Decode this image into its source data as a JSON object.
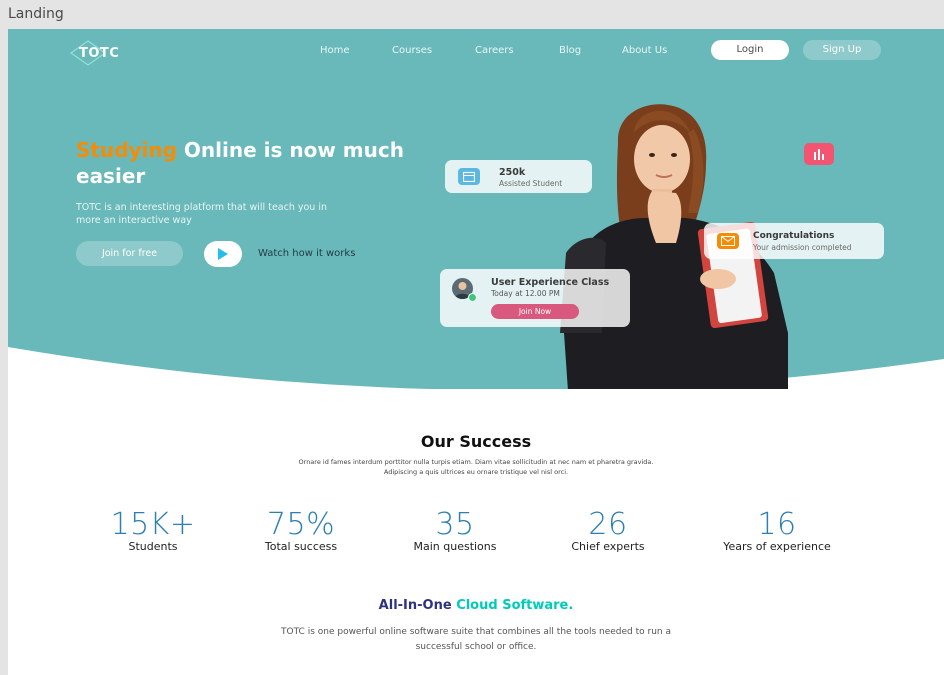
{
  "frame": {
    "label": "Landing"
  },
  "nav": {
    "logo_text": "TOTC",
    "links": [
      "Home",
      "Courses",
      "Careers",
      "Blog",
      "About Us"
    ],
    "login_label": "Login",
    "signup_label": "Sign Up"
  },
  "hero": {
    "title_accent": "Studying",
    "title_rest": " Online is now much easier",
    "description": "TOTC is an interesting platform that will teach you in more an interactive way",
    "join_label": "Join for free",
    "watch_label": "Watch how it works",
    "cards": {
      "assisted_value": "250k",
      "assisted_label": "Assisted Student",
      "congrats_title": "Congratulations",
      "congrats_sub": "Your admission completed",
      "class_title": "User Experience Class",
      "class_time": "Today at 12.00 PM",
      "class_button": "Join Now"
    }
  },
  "success": {
    "title": "Our Success",
    "description": "Ornare id fames interdum porttitor nulla turpis etiam. Diam vitae sollicitudin at nec nam et pharetra gravida. Adipiscing a quis ultrices eu ornare tristique vel nisl orci.",
    "stats": [
      {
        "value": "15K+",
        "label": "Students"
      },
      {
        "value": "75%",
        "label": "Total success"
      },
      {
        "value": "35",
        "label": "Main questions"
      },
      {
        "value": "26",
        "label": "Chief experts"
      },
      {
        "value": "16",
        "label": "Years of experience"
      }
    ]
  },
  "all_in_one": {
    "title_part1": "All-In-One ",
    "title_part2": "Cloud Software.",
    "description": "TOTC is one powerful online software suite that combines all the tools needed to run a successful school or office."
  },
  "colors": {
    "hero_bg": "#69b9ba",
    "accent_orange": "#f48c06",
    "stat_blue": "#2c7fb0",
    "heading_navy": "#2f327d",
    "accent_teal": "#00cbb8",
    "join_now_pink": "#d8587e"
  }
}
